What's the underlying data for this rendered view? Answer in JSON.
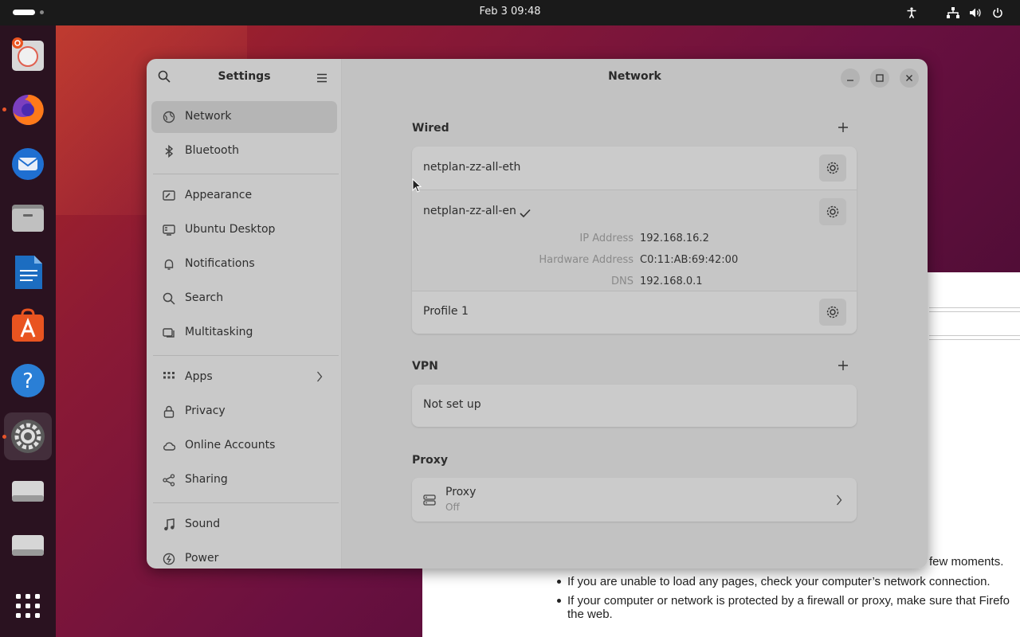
{
  "topbar": {
    "clock": "Feb 3  09:48"
  },
  "dock": {
    "items": [
      {
        "name": "ubuntu-installer",
        "running": false
      },
      {
        "name": "firefox",
        "running": true
      },
      {
        "name": "thunderbird",
        "running": false
      },
      {
        "name": "files",
        "running": false
      },
      {
        "name": "libreoffice-writer",
        "running": false
      },
      {
        "name": "app-center",
        "running": false
      },
      {
        "name": "help",
        "running": false
      },
      {
        "name": "settings",
        "running": true
      },
      {
        "name": "disk-1",
        "running": false
      },
      {
        "name": "disk-2",
        "running": false
      },
      {
        "name": "show-apps",
        "running": false
      }
    ]
  },
  "browser_behind": {
    "line1_tail": "few moments.",
    "bullet1": "If you are unable to load any pages, check your computer’s network connection.",
    "bullet2_line1": "If your computer or network is protected by a firewall or proxy, make sure that Firefo",
    "bullet2_line2": "the web."
  },
  "settings": {
    "sidebar_title": "Settings",
    "items": [
      {
        "label": "Network",
        "icon": "network-icon"
      },
      {
        "label": "Bluetooth",
        "icon": "bluetooth-icon"
      },
      {
        "label": "Appearance",
        "icon": "appearance-icon"
      },
      {
        "label": "Ubuntu Desktop",
        "icon": "desktop-icon"
      },
      {
        "label": "Notifications",
        "icon": "bell-icon"
      },
      {
        "label": "Search",
        "icon": "search-icon"
      },
      {
        "label": "Multitasking",
        "icon": "multitasking-icon"
      },
      {
        "label": "Apps",
        "icon": "apps-grid-icon"
      },
      {
        "label": "Privacy",
        "icon": "lock-icon"
      },
      {
        "label": "Online Accounts",
        "icon": "cloud-icon"
      },
      {
        "label": "Sharing",
        "icon": "share-icon"
      },
      {
        "label": "Sound",
        "icon": "music-note-icon"
      },
      {
        "label": "Power",
        "icon": "power-icon"
      }
    ],
    "page_title": "Network",
    "wired": {
      "title": "Wired",
      "connections": [
        {
          "name": "netplan-zz-all-eth"
        },
        {
          "name": "netplan-zz-all-en",
          "connected": true,
          "details": {
            "ip_label": "IP Address",
            "ip_value": "192.168.16.2",
            "hw_label": "Hardware Address",
            "hw_value": "C0:11:AB:69:42:00",
            "dns_label": "DNS",
            "dns_value": "192.168.0.1"
          }
        },
        {
          "name": "Profile 1"
        }
      ]
    },
    "vpn": {
      "title": "VPN",
      "status": "Not set up"
    },
    "proxy": {
      "title": "Proxy",
      "row_label": "Proxy",
      "row_sub": "Off"
    }
  },
  "colors": {
    "accent_dot": "#e8542a",
    "sidebar_bg": "#c9c9c9",
    "main_bg": "#c2c2c2"
  }
}
